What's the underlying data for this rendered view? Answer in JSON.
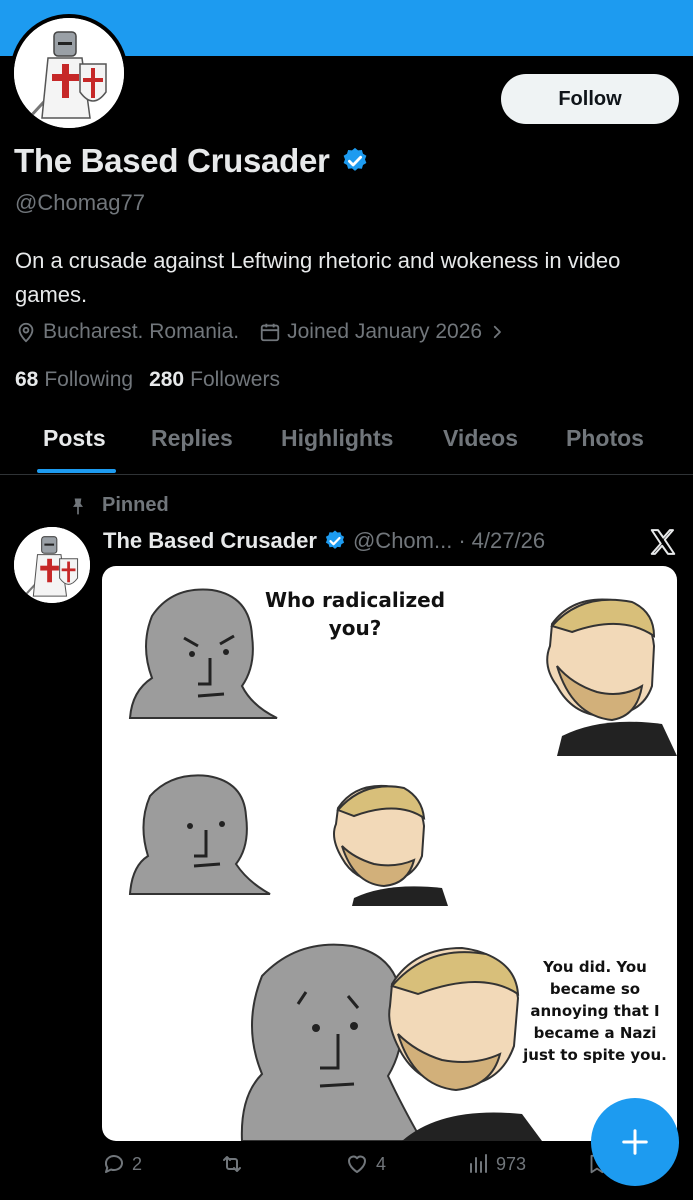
{
  "profile": {
    "display_name": "The Based Crusader",
    "handle": "@Chomag77",
    "bio": "On a crusade against Leftwing rhetoric and wokeness in video games.",
    "location": "Bucharest. Romania.",
    "joined": "Joined January 2026",
    "following_count": "68",
    "following_label": "Following",
    "followers_count": "280",
    "followers_label": "Followers",
    "follow_button": "Follow",
    "verified": true,
    "banner_color": "#1d9bf0"
  },
  "tabs": [
    {
      "label": "Posts",
      "active": true
    },
    {
      "label": "Replies",
      "active": false
    },
    {
      "label": "Highlights",
      "active": false
    },
    {
      "label": "Videos",
      "active": false
    },
    {
      "label": "Photos",
      "active": false
    }
  ],
  "post": {
    "pinned_label": "Pinned",
    "author_name": "The Based Crusader",
    "author_handle": "@Chom...",
    "separator": "·",
    "date": "4/27/26",
    "meme_question": "Who radicalized you?",
    "meme_answer": "You did. You became so annoying that I became a Nazi just to spite you.",
    "stats": {
      "replies": "2",
      "likes": "4",
      "views": "973"
    }
  },
  "icons": {
    "verified": "verified-badge-icon",
    "location": "location-pin-icon",
    "calendar": "calendar-icon",
    "chevron": "chevron-right-icon",
    "pin": "pin-icon",
    "x_logo": "x-logo-icon",
    "reply": "reply-icon",
    "repost": "repost-icon",
    "like": "heart-icon",
    "views": "views-icon",
    "bookmark": "bookmark-icon",
    "compose": "compose-plus-icon"
  },
  "colors": {
    "accent": "#1d9bf0",
    "background": "#000000",
    "text": "#e7e9ea",
    "muted": "#71767b"
  }
}
